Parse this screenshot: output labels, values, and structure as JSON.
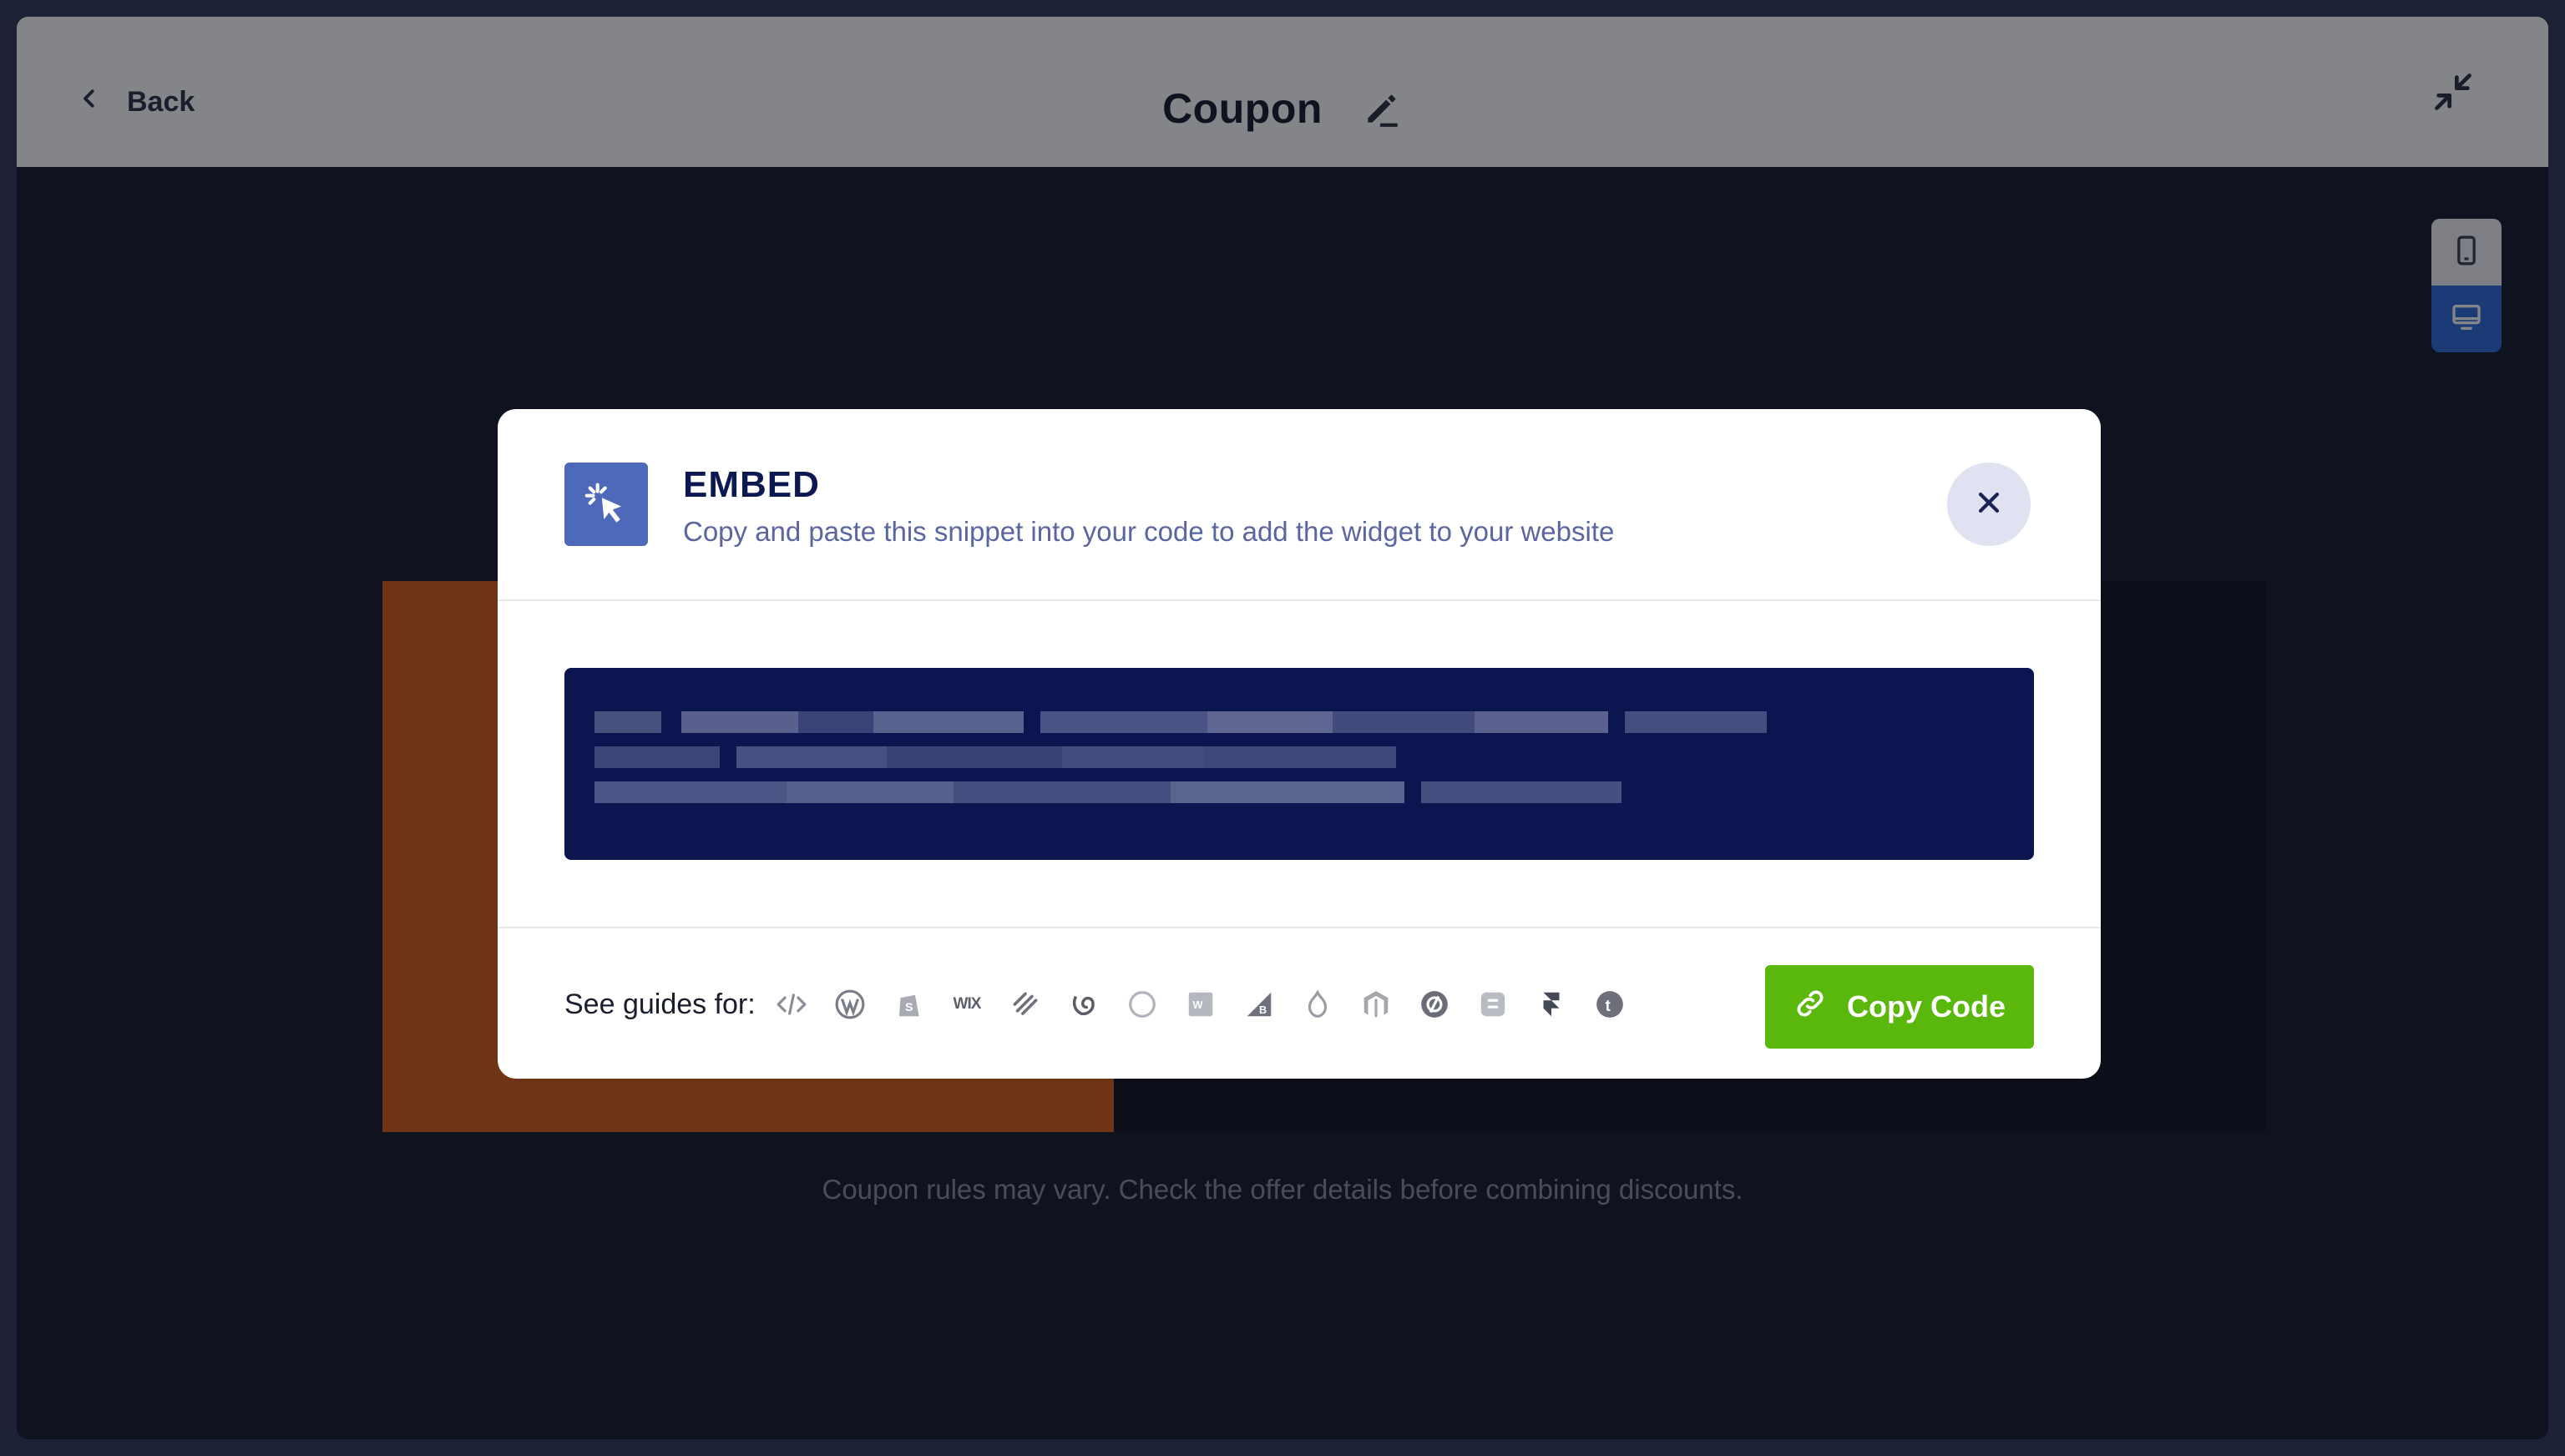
{
  "header": {
    "back_label": "Back",
    "title": "Coupon"
  },
  "preview": {
    "note": "Coupon rules may vary. Check the offer details before combining discounts.",
    "accent_color": "#d45a17"
  },
  "modal": {
    "title": "EMBED",
    "subtitle": "Copy and paste this snippet into your code to add the widget to your website",
    "code_redacted": true,
    "guides_label": "See guides for:",
    "guide_platforms": [
      "html-code-icon",
      "wordpress-icon",
      "shopify-icon",
      "wix-icon",
      "squarespace-icon",
      "webflow-icon",
      "circle-icon",
      "weebly-icon",
      "bigcommerce-icon",
      "drupal-icon",
      "magento-icon",
      "odoo-icon",
      "blogger-icon",
      "framer-icon",
      "tumblr-icon"
    ],
    "wix_text": "WIX",
    "copy_button_label": "Copy Code",
    "copy_button_color": "#5ab70b",
    "code_bg_color": "#0b1651"
  }
}
